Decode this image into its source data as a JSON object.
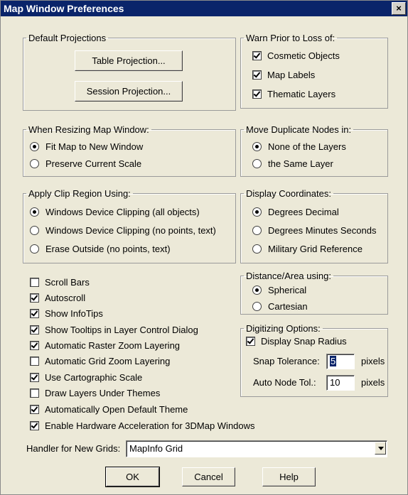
{
  "window": {
    "title": "Map Window Preferences",
    "close_glyph": "×"
  },
  "default_projections": {
    "legend": "Default Projections",
    "table_button": "Table Projection...",
    "session_button": "Session Projection..."
  },
  "warn_prior": {
    "legend": "Warn Prior to Loss of:",
    "options": [
      {
        "label": "Cosmetic Objects",
        "checked": true
      },
      {
        "label": "Map Labels",
        "checked": true
      },
      {
        "label": "Thematic Layers",
        "checked": true
      }
    ]
  },
  "resizing": {
    "legend": "When Resizing Map Window:",
    "options": [
      {
        "label": "Fit Map to New Window",
        "selected": true
      },
      {
        "label": "Preserve Current Scale",
        "selected": false
      }
    ]
  },
  "duplicate_nodes": {
    "legend": "Move Duplicate Nodes in:",
    "options": [
      {
        "label": "None of the Layers",
        "selected": true
      },
      {
        "label": "the Same Layer",
        "selected": false
      }
    ]
  },
  "clip_region": {
    "legend": "Apply Clip Region Using:",
    "options": [
      {
        "label": "Windows Device Clipping (all objects)",
        "selected": true
      },
      {
        "label": "Windows Device Clipping (no points, text)",
        "selected": false
      },
      {
        "label": "Erase Outside (no points, text)",
        "selected": false
      }
    ]
  },
  "display_coords": {
    "legend": "Display Coordinates:",
    "options": [
      {
        "label": "Degrees Decimal",
        "selected": true
      },
      {
        "label": "Degrees Minutes Seconds",
        "selected": false
      },
      {
        "label": "Military Grid Reference",
        "selected": false
      }
    ]
  },
  "checkboxes": [
    {
      "label": "Scroll Bars",
      "checked": false
    },
    {
      "label": "Autoscroll",
      "checked": true
    },
    {
      "label": "Show InfoTips",
      "checked": true
    },
    {
      "label": "Show Tooltips in Layer Control Dialog",
      "checked": true
    },
    {
      "label": "Automatic Raster Zoom Layering",
      "checked": true
    },
    {
      "label": "Automatic Grid Zoom Layering",
      "checked": false
    },
    {
      "label": "Use Cartographic Scale",
      "checked": true
    },
    {
      "label": "Draw Layers Under Themes",
      "checked": false
    },
    {
      "label": "Automatically Open Default Theme",
      "checked": true
    },
    {
      "label": "Enable Hardware Acceleration for 3DMap Windows",
      "checked": true
    }
  ],
  "distance_area": {
    "legend": "Distance/Area using:",
    "options": [
      {
        "label": "Spherical",
        "selected": true
      },
      {
        "label": "Cartesian",
        "selected": false
      }
    ]
  },
  "digitizing": {
    "legend": "Digitizing Options:",
    "snap_radius": {
      "label": "Display Snap Radius",
      "checked": true
    },
    "snap_tolerance": {
      "label": "Snap Tolerance:",
      "value": "5",
      "unit": "pixels"
    },
    "auto_node": {
      "label": "Auto Node Tol.:",
      "value": "10",
      "unit": "pixels"
    }
  },
  "grid_handler": {
    "label": "Handler for New Grids:",
    "value": "MapInfo Grid"
  },
  "buttons": {
    "ok": "OK",
    "cancel": "Cancel",
    "help": "Help"
  }
}
